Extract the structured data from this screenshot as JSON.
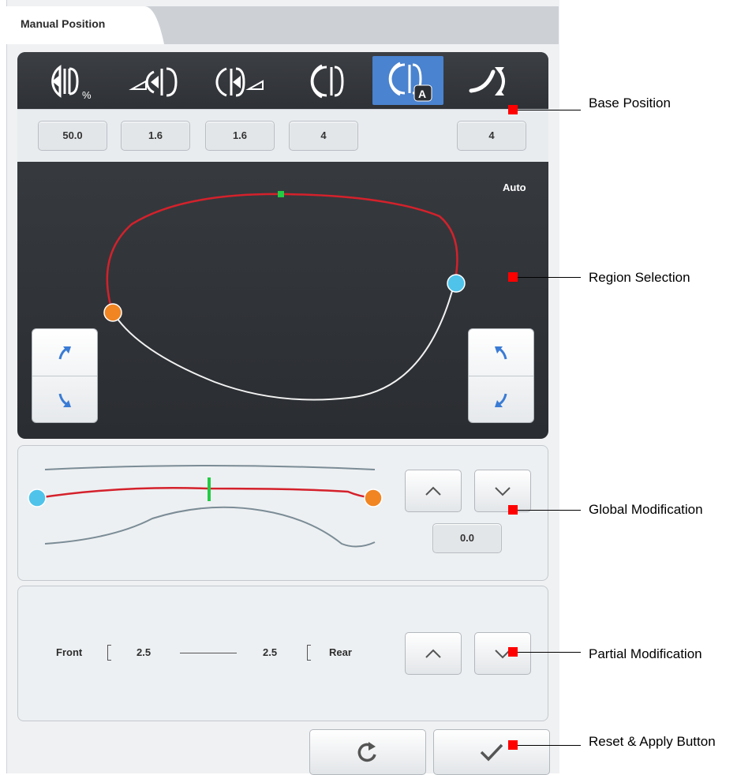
{
  "tab": {
    "label": "Manual Position"
  },
  "toolbar": {
    "icons": [
      "bevel-percent-icon",
      "bevel-front-icon",
      "bevel-rear-icon",
      "bevel-curve-icon",
      "bevel-auto-icon",
      "rotate-curve-icon"
    ],
    "active_index": 4,
    "auto_badge": "A",
    "percent_sub": "%"
  },
  "base_values": {
    "v1": "50.0",
    "v2": "1.6",
    "v3": "1.6",
    "v4": "4",
    "v5": "4"
  },
  "region": {
    "mode_label": "Auto"
  },
  "global_mod": {
    "value": "0.0"
  },
  "partial_mod": {
    "front_label": "Front",
    "front_value": "2.5",
    "rear_value": "2.5",
    "rear_label": "Rear"
  },
  "callouts": {
    "base_position": "Base Position",
    "region_selection": "Region Selection",
    "global_modification": "Global Modification",
    "partial_modification": "Partial Modification",
    "reset_apply": "Reset & Apply Button"
  },
  "colors": {
    "accent": "#4a83cf",
    "red_curve": "#d4212b",
    "cyan_handle": "#4fc3ea",
    "orange_handle": "#f08522",
    "marker": "#ff0000"
  }
}
